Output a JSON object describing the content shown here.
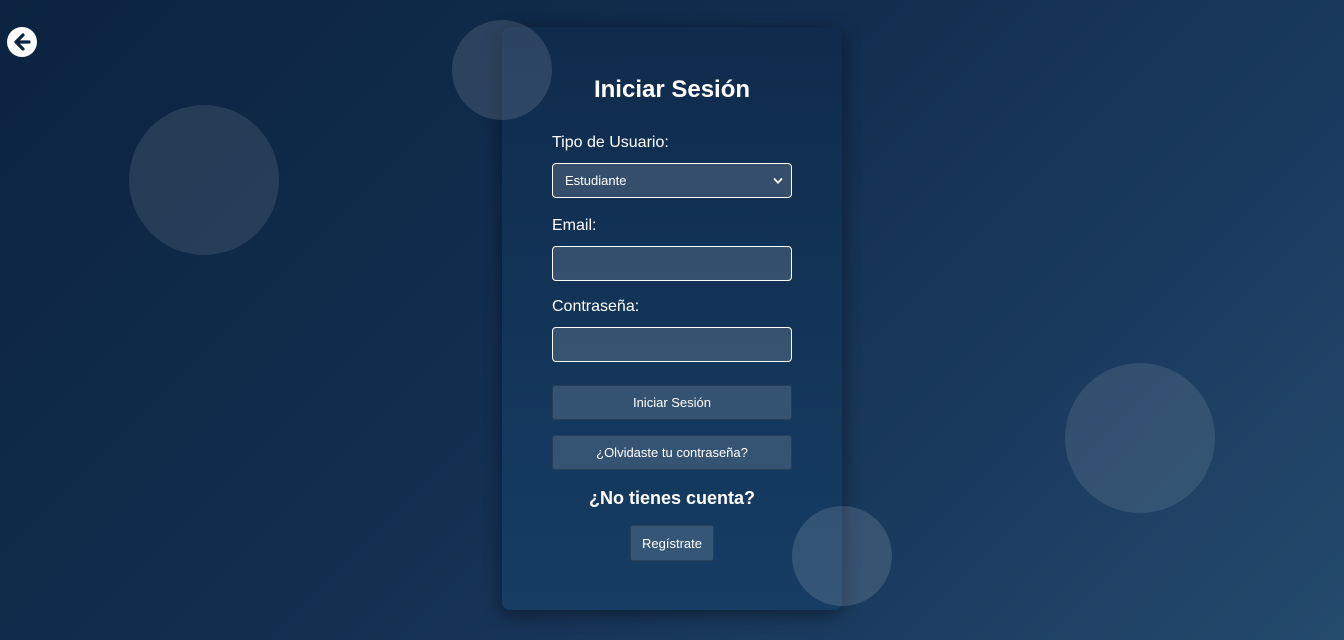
{
  "back": {
    "icon": "arrow-left-icon"
  },
  "login": {
    "title": "Iniciar Sesión",
    "user_type": {
      "label": "Tipo de Usuario:",
      "selected": "Estudiante",
      "icon": "chevron-down-icon"
    },
    "email": {
      "label": "Email:",
      "value": "",
      "placeholder": ""
    },
    "password": {
      "label": "Contraseña:",
      "value": "",
      "placeholder": ""
    },
    "submit_label": "Iniciar Sesión",
    "forgot_label": "¿Olvidaste tu contraseña?",
    "no_account_text": "¿No tienes cuenta?",
    "register_label": "Regístrate"
  },
  "colors": {
    "background_start": "#0b2340",
    "background_end": "#244a6c",
    "card": "#123459",
    "text": "#ffffff"
  }
}
